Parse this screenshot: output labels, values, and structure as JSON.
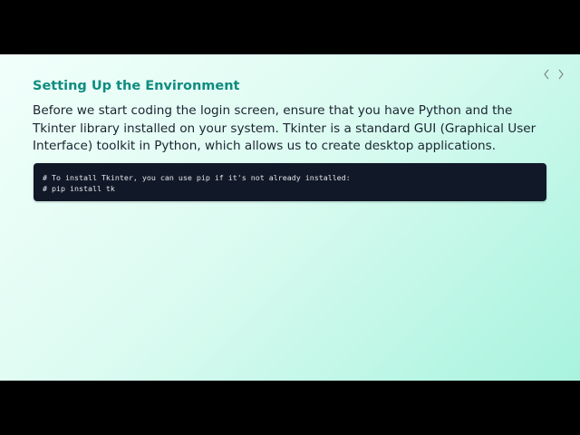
{
  "slide": {
    "title": "Setting Up the Environment",
    "body": "Before we start coding the login screen, ensure that you have Python and the Tkinter library installed on your system. Tkinter is a standard GUI (Graphical User Interface) toolkit in Python, which allows us to create desktop applications.",
    "code_lines": [
      "# To install Tkinter, you can use pip if it's not already installed:",
      "# pip install tk"
    ]
  },
  "nav": {
    "prev_icon": "chevron-left-icon",
    "next_icon": "chevron-right-icon"
  },
  "colors": {
    "title": "#0f8c80",
    "code_background": "#111827",
    "background_start": "#f2fffb",
    "background_end": "#a8f3de"
  }
}
